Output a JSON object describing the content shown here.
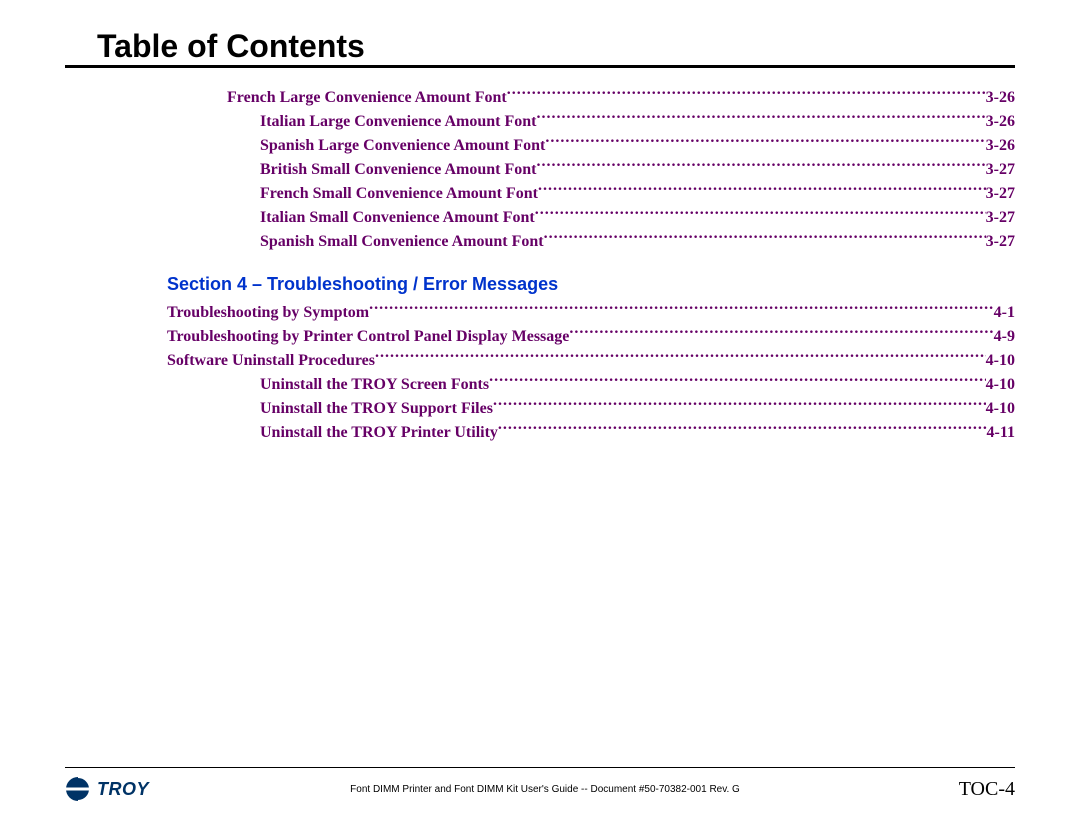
{
  "header": {
    "title": "Table of Contents"
  },
  "toc_upper": [
    {
      "label": "French Large Convenience Amount Font",
      "page": "3-26",
      "indent": "a"
    },
    {
      "label": "Italian Large Convenience Amount Font",
      "page": "3-26",
      "indent": "b"
    },
    {
      "label": "Spanish Large Convenience Amount Font",
      "page": "3-26",
      "indent": "b"
    },
    {
      "label": "British Small Convenience Amount Font",
      "page": "3-27",
      "indent": "b"
    },
    {
      "label": "French Small Convenience Amount Font",
      "page": "3-27",
      "indent": "b"
    },
    {
      "label": "Italian Small Convenience Amount Font",
      "page": "3-27",
      "indent": "b"
    },
    {
      "label": "Spanish Small Convenience Amount Font",
      "page": "3-27",
      "indent": "b"
    }
  ],
  "section4": {
    "heading": "Section 4 – Troubleshooting / Error Messages",
    "entries": [
      {
        "label": "Troubleshooting by Symptom",
        "page": "4-1",
        "indent": "c"
      },
      {
        "label": "Troubleshooting by Printer Control Panel Display Message",
        "page": "4-9",
        "indent": "c"
      },
      {
        "label": "Software Uninstall Procedures",
        "page": "4-10",
        "indent": "c"
      },
      {
        "label": "Uninstall the TROY Screen Fonts",
        "page": "4-10",
        "indent": "b"
      },
      {
        "label": "Uninstall the TROY Support Files",
        "page": "4-10",
        "indent": "b"
      },
      {
        "label": "Uninstall the TROY Printer Utility",
        "page": "4-11",
        "indent": "b"
      }
    ]
  },
  "footer": {
    "logo_text": "TROY",
    "center": "Font DIMM Printer and Font DIMM Kit User's Guide -- Document #50-70382-001  Rev. G",
    "page": "TOC-4"
  }
}
